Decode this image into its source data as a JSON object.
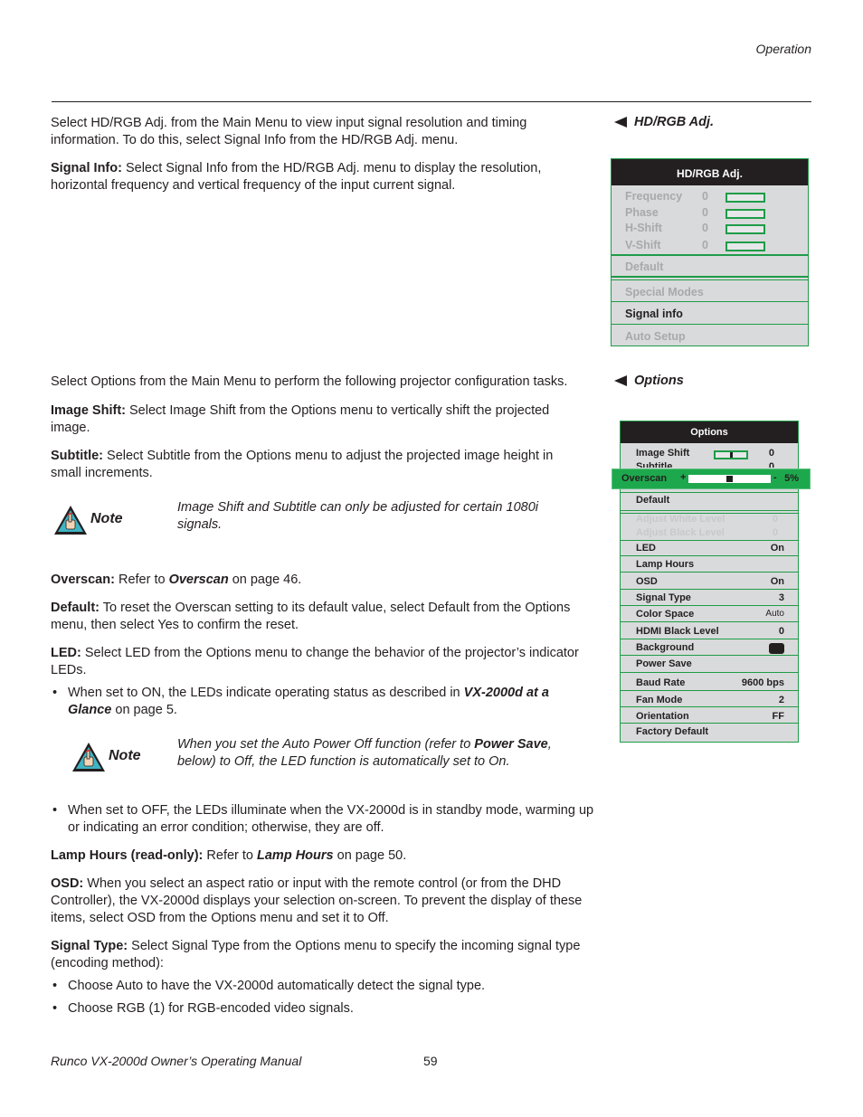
{
  "header": {
    "section": "Operation"
  },
  "intro_hdrgb": "Select HD/RGB Adj. from the Main Menu to view input signal resolution and timing information. To do this, select Signal Info from the HD/RGB Adj. menu.",
  "signal_info": {
    "label": "Signal Info:",
    "text": " Select Signal Info from the HD/RGB Adj. menu to display the resolution, horizontal frequency and vertical frequency of the input current signal."
  },
  "hdrgb_heading": "HD/RGB Adj.",
  "hdrgb_menu": {
    "title": "HD/RGB Adj.",
    "sliders": [
      {
        "label": "Frequency",
        "value": "0"
      },
      {
        "label": "Phase",
        "value": "0"
      },
      {
        "label": "H-Shift",
        "value": "0"
      },
      {
        "label": "V-Shift",
        "value": "0"
      }
    ],
    "items": [
      "Default",
      "Special Modes",
      "Signal info",
      "Auto Setup"
    ]
  },
  "intro_options": "Select Options from the Main Menu to perform the following projector configuration tasks.",
  "options_heading": "Options",
  "image_shift": {
    "label": "Image Shift:",
    "text": " Select Image Shift from the Options menu to vertically shift the projected image."
  },
  "subtitle": {
    "label": "Subtitle:",
    "text": " Select Subtitle from the Options menu to adjust the projected image height in small increments."
  },
  "note1": {
    "label": "Note",
    "text": "Image Shift and Subtitle can only be adjusted for certain 1080i signals."
  },
  "overscan": {
    "label": "Overscan:",
    "pre": " Refer to ",
    "ref": "Overscan",
    "post": " on page 46."
  },
  "default": {
    "label": "Default:",
    "text": " To reset the Overscan setting to its default value, select Default from the Options menu, then select Yes to confirm the reset."
  },
  "led": {
    "label": "LED:",
    "text": " Select LED from the Options menu to change the behavior of the projector’s indicator LEDs."
  },
  "led_bullet_on": {
    "pre": "When set to ON, the LEDs indicate operating status as described in ",
    "ref": "VX-2000d at a Glance",
    "post": " on page 5."
  },
  "note2": {
    "label": "Note",
    "pre": "When you set the Auto Power Off function (refer to ",
    "ref": "Power Save",
    "post": ", below) to Off, the LED function is automatically set to On."
  },
  "led_bullet_off": "When set to OFF, the LEDs illuminate when the VX-2000d is in standby mode, warming up or indicating an error condition; otherwise, they are off.",
  "lamp_hours": {
    "label": "Lamp Hours (read-only):",
    "pre": " Refer to ",
    "ref": "Lamp Hours",
    "post": " on page 50."
  },
  "osd": {
    "label": "OSD:",
    "text": " When you select an aspect ratio or input with the remote control (or from the DHD Controller), the VX-2000d displays your selection on-screen. To prevent the display of these items, select OSD from the Options menu and set it to Off."
  },
  "signal_type": {
    "label": "Signal Type:",
    "text": " Select Signal Type from the Options menu to specify the incoming signal type (encoding method):"
  },
  "signal_type_bullets": [
    "Choose Auto to have the VX-2000d automatically detect the signal type.",
    "Choose RGB (1) for RGB-encoded video signals."
  ],
  "options_menu": {
    "title": "Options",
    "image_shift": {
      "label": "Image Shift",
      "value": "0",
      "slider_fraction": 0.5
    },
    "subtitle": {
      "label": "Subtitle",
      "value": "0"
    },
    "overscan": {
      "label": "Overscan",
      "plus": "+",
      "minus": "-",
      "value": "5%",
      "slider_fraction": 0.5
    },
    "default_label": "Default",
    "adjust_white": {
      "label": "Adjust White Level",
      "value": "0"
    },
    "adjust_black": {
      "label": "Adjust Black Level",
      "value": "0"
    },
    "rows": [
      {
        "label": "LED",
        "value": "On"
      },
      {
        "label": "Lamp Hours",
        "value": ""
      },
      {
        "label": "OSD",
        "value": "On"
      },
      {
        "label": "Signal Type",
        "value": "3"
      },
      {
        "label": "Color Space",
        "value": "Auto"
      },
      {
        "label": "HDMI Black Level",
        "value": "0"
      },
      {
        "label": "Background",
        "value": ""
      },
      {
        "label": "Power Save",
        "value": ""
      },
      {
        "label": "Baud Rate",
        "value": "9600 bps"
      },
      {
        "label": "Fan Mode",
        "value": "2"
      },
      {
        "label": "Orientation",
        "value": "FF"
      },
      {
        "label": "Factory Default",
        "value": ""
      }
    ]
  },
  "footer": {
    "manual": "Runco VX-2000d Owner’s Operating Manual",
    "page": "59"
  }
}
